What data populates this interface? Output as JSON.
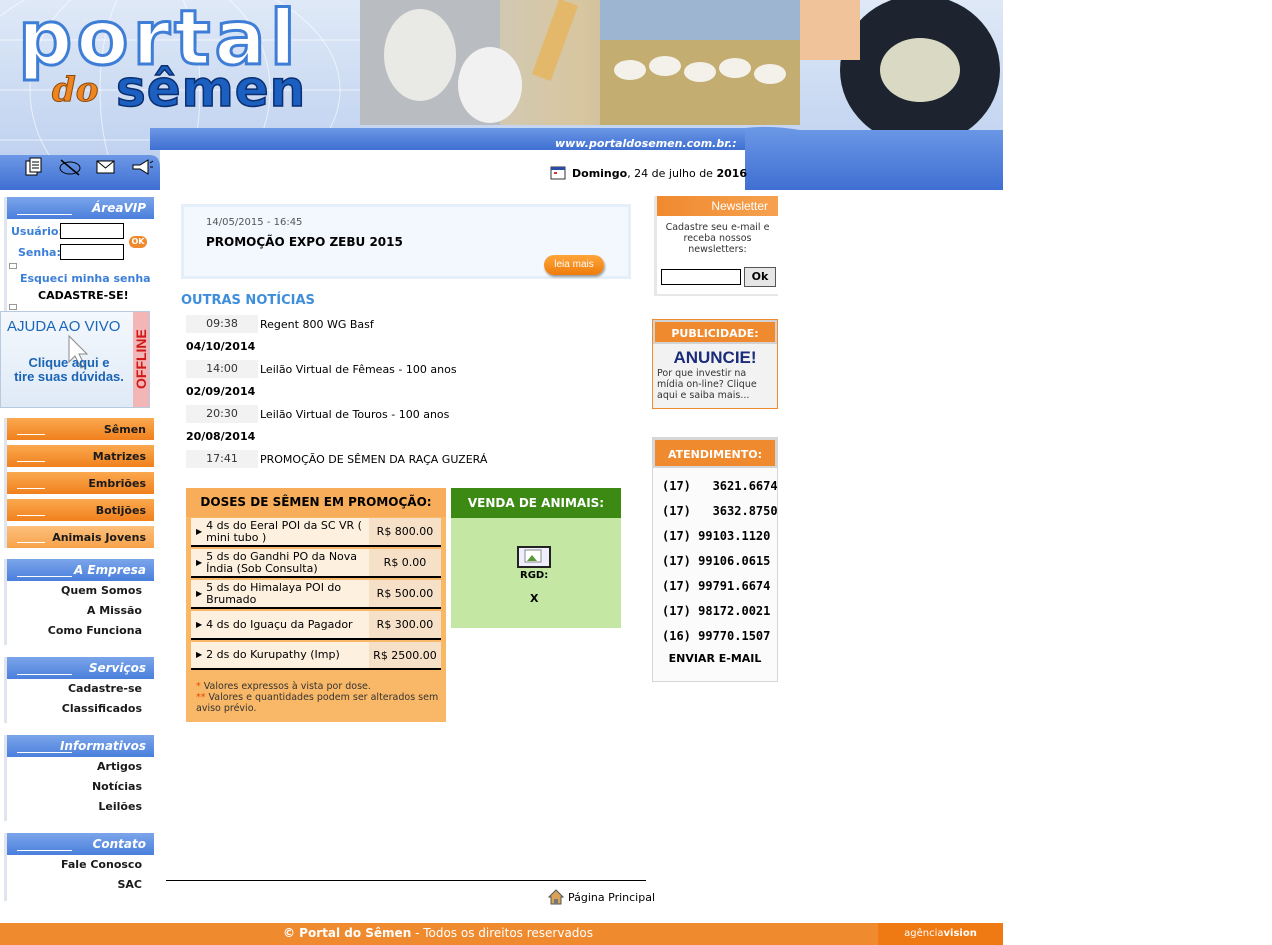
{
  "header": {
    "logo_portal": "portal",
    "logo_do": "do",
    "logo_semen": "sêmen",
    "url": "www.portaldosemen.com.br.:",
    "date_weekday": "Domingo",
    "date_middle": ", 24 de julho de",
    "date_year": "2016"
  },
  "vip": {
    "title": "ÁreaVIP",
    "user_label": "Usuário:",
    "pass_label": "Senha:",
    "ok": "OK",
    "forgot": "Esqueci minha senha",
    "register": "CADASTRE-SE!"
  },
  "ajuda": {
    "title": "AJUDA AO VIVO",
    "subtitle_line1": "Clique aqui e",
    "subtitle_line2": "tire suas dúvidas.",
    "status": "OFFLINE"
  },
  "sidebar": {
    "products": [
      {
        "label": "Sêmen"
      },
      {
        "label": "Matrizes"
      },
      {
        "label": "Embriões"
      },
      {
        "label": "Botijões"
      },
      {
        "label": "Animais Jovens"
      }
    ],
    "empresa": {
      "title": "A Empresa",
      "items": [
        "Quem Somos",
        "A Missão",
        "Como Funciona"
      ]
    },
    "servicos": {
      "title": "Serviços",
      "items": [
        "Cadastre-se",
        "Classificados"
      ]
    },
    "informativos": {
      "title": "Informativos",
      "items": [
        "Artigos",
        "Notícias",
        "Leilões"
      ]
    },
    "contato": {
      "title": "Contato",
      "items": [
        "Fale Conosco",
        "SAC"
      ]
    }
  },
  "featured": {
    "date": "14/05/2015 - 16:45",
    "title": "PROMOÇÃO EXPO ZEBU 2015",
    "button": "leia mais"
  },
  "outras": {
    "title": "OUTRAS NOTÍCIAS",
    "entries": [
      {
        "time": "09:38",
        "title": "Regent 800 WG Basf"
      },
      {
        "date": "04/10/2014"
      },
      {
        "time": "14:00",
        "title": "Leilão Virtual de Fêmeas - 100 anos"
      },
      {
        "date": "02/09/2014"
      },
      {
        "time": "20:30",
        "title": "Leilão Virtual de Touros - 100 anos"
      },
      {
        "date": "20/08/2014"
      },
      {
        "time": "17:41",
        "title": "PROMOÇÃO DE SÊMEN DA RAÇA GUZERÁ"
      }
    ]
  },
  "doses": {
    "title": "DOSES DE SÊMEN EM PROMOÇÃO:",
    "rows": [
      {
        "name": "4 ds do Eeral POI da SC VR ( mini tubo )",
        "price": "R$ 800.00"
      },
      {
        "name": "5 ds do Gandhi PO da Nova Índia (Sob Consulta)",
        "price": "R$ 0.00"
      },
      {
        "name": "5 ds do Himalaya POI do Brumado",
        "price": "R$ 500.00"
      },
      {
        "name": "4 ds do Iguaçu da Pagador",
        "price": "R$ 300.00"
      },
      {
        "name": "2 ds do Kurupathy (Imp)",
        "price": "R$ 2500.00"
      }
    ],
    "note1_star": "*",
    "note1": "Valores expressos à vista por dose.",
    "note2_star": "**",
    "note2": "Valores e quantidades podem ser alterados sem aviso prévio."
  },
  "venda": {
    "title": "VENDA DE ANIMAIS:",
    "rgd": "RGD:",
    "value": "X"
  },
  "newsletter": {
    "title": "Newsletter",
    "text": "Cadastre seu e-mail e receba nossos newsletters:",
    "ok": "Ok"
  },
  "publicidade": {
    "title": "PUBLICIDADE:",
    "big": "ANUNCIE!",
    "text": "Por que investir na mídia on-line? Clique aqui e saiba mais..."
  },
  "atendimento": {
    "title": "ATENDIMENTO:",
    "phones": [
      "(17)   3621.6674",
      "(17)   3632.8750",
      "(17) 99103.1120",
      "(17) 99106.0615",
      "(17) 99791.6674",
      "(17) 98172.0021",
      "(16) 99770.1507"
    ],
    "email": "ENVIAR E-MAIL"
  },
  "bottom": {
    "home_link": "Página Principal"
  },
  "footer": {
    "brand": "© Portal do Sêmen",
    "rights": " - Todos os direitos reservados",
    "agency_a": "agência",
    "agency_b": "vision"
  },
  "colors": {
    "orange": "#f08a2f",
    "blue": "#4a7fdc",
    "green": "#3c8a14"
  }
}
